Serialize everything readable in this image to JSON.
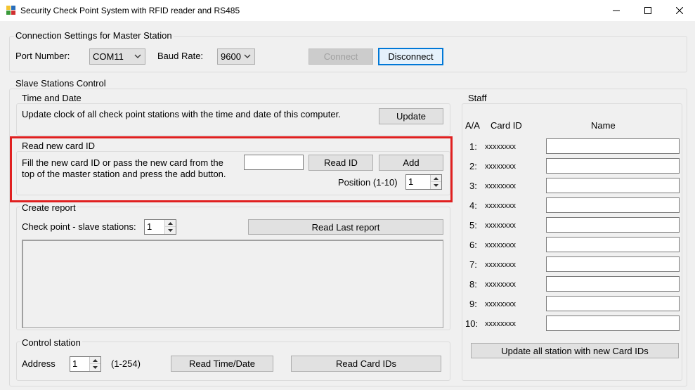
{
  "window": {
    "title": "Security Check Point System with RFID reader and RS485",
    "controls": [
      "minimize",
      "maximize",
      "close"
    ]
  },
  "connection": {
    "group_title": "Connection Settings for Master Station",
    "port_label": "Port Number:",
    "port_value": "COM11",
    "baud_label": "Baud Rate:",
    "baud_value": "9600",
    "connect_label": "Connect",
    "disconnect_label": "Disconnect"
  },
  "slave": {
    "group_title": "Slave Stations Control",
    "time": {
      "title": "Time and Date",
      "description": "Update clock of all check point stations with the time and date of this computer.",
      "update_label": "Update"
    },
    "read_card": {
      "title": "Read new card ID",
      "description_line1": "Fill the new card ID or pass the new card from the",
      "description_line2": "top of the master station and press the add button.",
      "card_id_value": "",
      "read_id_label": "Read ID",
      "add_label": "Add",
      "position_label": "Position (1-10)",
      "position_value": "1"
    },
    "report": {
      "title": "Create report",
      "checkpoint_label": "Check point - slave stations:",
      "checkpoint_value": "1",
      "read_last_label": "Read Last report"
    },
    "control": {
      "title": "Control station",
      "address_label": "Address",
      "address_value": "1",
      "range_label": "(1-254)",
      "read_time_label": "Read Time/Date",
      "read_cards_label": "Read Card IDs"
    }
  },
  "staff": {
    "title": "Staff",
    "col_aa": "A/A",
    "col_card": "Card ID",
    "col_name": "Name",
    "rows": [
      {
        "num": "1:",
        "card": "xxxxxxxx",
        "name": ""
      },
      {
        "num": "2:",
        "card": "xxxxxxxx",
        "name": ""
      },
      {
        "num": "3:",
        "card": "xxxxxxxx",
        "name": ""
      },
      {
        "num": "4:",
        "card": "xxxxxxxx",
        "name": ""
      },
      {
        "num": "5:",
        "card": "xxxxxxxx",
        "name": ""
      },
      {
        "num": "6:",
        "card": "xxxxxxxx",
        "name": ""
      },
      {
        "num": "7:",
        "card": "xxxxxxxx",
        "name": ""
      },
      {
        "num": "8:",
        "card": "xxxxxxxx",
        "name": ""
      },
      {
        "num": "9:",
        "card": "xxxxxxxx",
        "name": ""
      },
      {
        "num": "10:",
        "card": "xxxxxxxx",
        "name": ""
      }
    ],
    "update_all_label": "Update all station with new Card IDs"
  },
  "colors": {
    "highlight": "#e02020",
    "focus": "#0078d7"
  }
}
